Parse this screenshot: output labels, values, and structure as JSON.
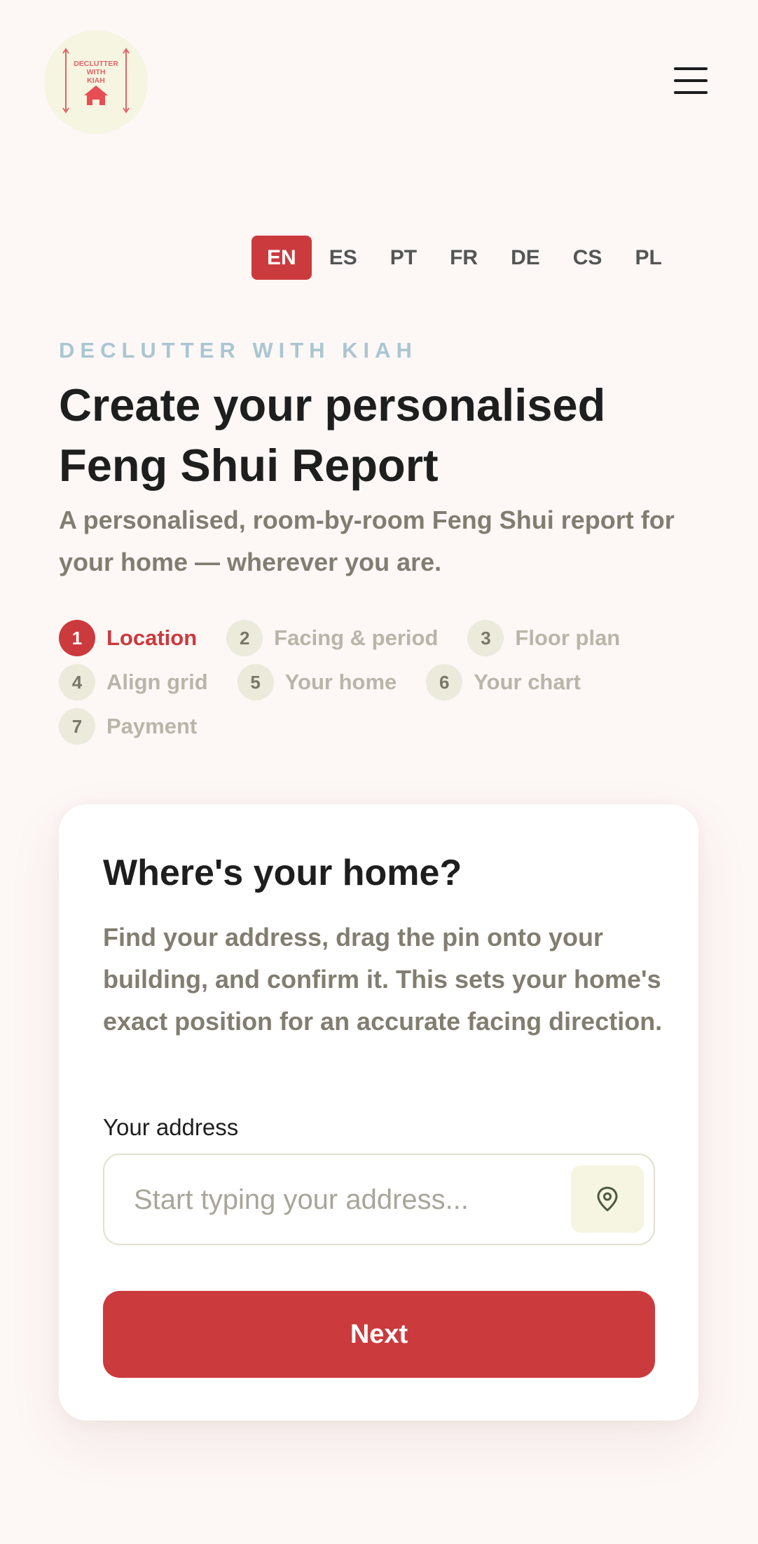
{
  "header": {
    "logo_text": [
      "DECLUTTER",
      "WITH",
      "KIAH"
    ],
    "menu_icon": "hamburger-icon"
  },
  "languages": {
    "items": [
      "EN",
      "ES",
      "PT",
      "FR",
      "DE",
      "CS",
      "PL"
    ],
    "selected": "EN"
  },
  "hero": {
    "eyebrow": "DECLUTTER WITH KIAH",
    "title": "Create your personalised Feng Shui Report",
    "subtitle": "A personalised, room-by-room Feng Shui report for your home — wherever you are."
  },
  "steps": [
    {
      "num": "1",
      "label": "Location",
      "active": true
    },
    {
      "num": "2",
      "label": "Facing & period",
      "active": false
    },
    {
      "num": "3",
      "label": "Floor plan",
      "active": false
    },
    {
      "num": "4",
      "label": "Align grid",
      "active": false
    },
    {
      "num": "5",
      "label": "Your home",
      "active": false
    },
    {
      "num": "6",
      "label": "Your chart",
      "active": false
    },
    {
      "num": "7",
      "label": "Payment",
      "active": false
    }
  ],
  "card": {
    "title": "Where's your home?",
    "description": "Find your address, drag the pin onto your building, and confirm it. This sets your home's exact position for an accurate facing direction.",
    "address_label": "Your address",
    "address_placeholder": "Start typing your address...",
    "address_value": "",
    "location_icon": "map-pin-icon",
    "next_label": "Next"
  },
  "colors": {
    "accent": "#cb3a3d",
    "background": "#fdf7f6",
    "eyebrow": "#a9c6d2",
    "muted_text": "#817d70",
    "logo_bg": "#f6f5e1"
  }
}
